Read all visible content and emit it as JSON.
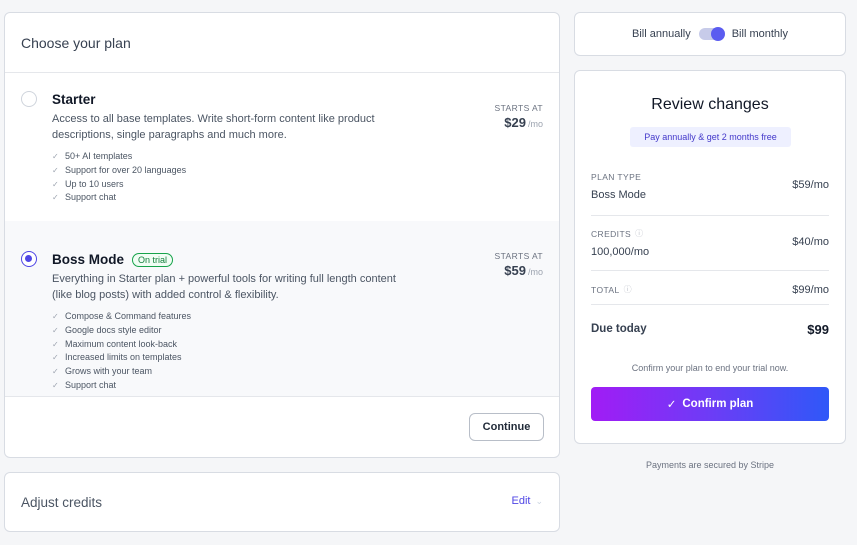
{
  "plan_card": {
    "title": "Choose your plan",
    "continue_label": "Continue"
  },
  "plans": [
    {
      "name": "Starter",
      "selected": false,
      "description": "Access to all base templates. Write short-form content like product descriptions, single paragraphs and much more.",
      "starts_at_label": "STARTS AT",
      "price": "$29",
      "per": "/mo",
      "features": [
        "50+ AI templates",
        "Support for over 20 languages",
        "Up to 10 users",
        "Support chat"
      ]
    },
    {
      "name": "Boss Mode",
      "badge": "On trial",
      "selected": true,
      "description": "Everything in Starter plan + powerful tools for writing full length content (like blog posts) with added control & flexibility.",
      "starts_at_label": "STARTS AT",
      "price": "$59",
      "per": "/mo",
      "features": [
        "Compose & Command features",
        "Google docs style editor",
        "Maximum content look-back",
        "Increased limits on templates",
        "Grows with your team",
        "Support chat"
      ]
    }
  ],
  "credits_card": {
    "title": "Adjust credits",
    "edit_label": "Edit"
  },
  "billing": {
    "annual_label": "Bill annually",
    "monthly_label": "Bill monthly",
    "selected": "monthly"
  },
  "review": {
    "title": "Review changes",
    "promo": "Pay annually & get 2 months free",
    "plan_type_label": "PLAN TYPE",
    "plan_type_value": "Boss Mode",
    "plan_type_amount": "$59/mo",
    "credits_label": "CREDITS",
    "credits_value": "100,000/mo",
    "credits_amount": "$40/mo",
    "total_label": "TOTAL",
    "total_amount": "$99/mo",
    "due_label": "Due today",
    "due_amount": "$99",
    "confirm_note": "Confirm your plan to end your trial now.",
    "confirm_label": "Confirm plan"
  },
  "footer_note": "Payments are secured by Stripe",
  "colors": {
    "accent": "#4f46e5",
    "toggle": "#5b5cf0",
    "badge_green": "#16a34a",
    "gradient_start": "#a11cf5",
    "gradient_end": "#2f58f8"
  }
}
